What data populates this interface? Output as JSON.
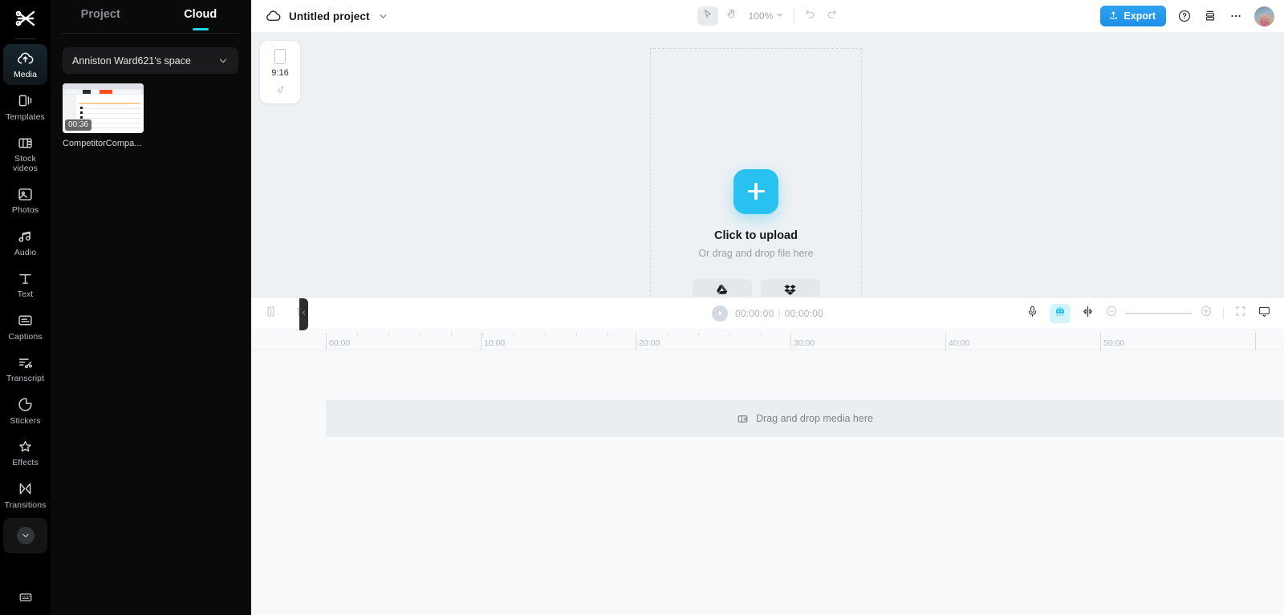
{
  "app": {
    "logo_icon": "capcut-logo-icon",
    "keyboard_shortcut_icon": "keyboard-icon"
  },
  "rail": {
    "items": [
      {
        "label": "Media",
        "icon": "cloud-upload-icon",
        "active": true
      },
      {
        "label": "Templates",
        "icon": "templates-icon",
        "active": false
      },
      {
        "label": "Stock videos",
        "icon": "film-strip-icon",
        "active": false
      },
      {
        "label": "Photos",
        "icon": "photo-icon",
        "active": false
      },
      {
        "label": "Audio",
        "icon": "music-note-icon",
        "active": false
      },
      {
        "label": "Text",
        "icon": "text-t-icon",
        "active": false
      },
      {
        "label": "Captions",
        "icon": "captions-icon",
        "active": false
      },
      {
        "label": "Transcript",
        "icon": "transcript-icon",
        "active": false
      },
      {
        "label": "Stickers",
        "icon": "sticker-icon",
        "active": false
      },
      {
        "label": "Effects",
        "icon": "sparkle-star-icon",
        "active": false
      },
      {
        "label": "Transitions",
        "icon": "transitions-icon",
        "active": false
      }
    ],
    "more_icon": "chevron-down-icon"
  },
  "panel": {
    "tabs": [
      {
        "label": "Project",
        "active": false
      },
      {
        "label": "Cloud",
        "active": true
      }
    ],
    "space_selector": {
      "value": "Anniston Ward621's space",
      "chevron_icon": "chevron-down-icon"
    },
    "media": [
      {
        "name": "CompetitorCompa...",
        "duration": "00:36"
      }
    ],
    "collapse_icon": "chevron-left-icon"
  },
  "topbar": {
    "cloud_icon": "cloud-icon",
    "project_title": "Untitled project",
    "title_chevron_icon": "chevron-down-icon",
    "tools": [
      {
        "name": "select-tool",
        "icon": "cursor-arrow-icon",
        "selected": true
      },
      {
        "name": "hand-tool",
        "icon": "hand-icon",
        "selected": false
      }
    ],
    "zoom_level": "100%",
    "zoom_chevron_icon": "chevron-down-icon",
    "undo_icon": "undo-icon",
    "redo_icon": "redo-icon",
    "export_label": "Export",
    "export_icon": "upload-icon",
    "help_icon": "question-circle-icon",
    "layout_icon": "layout-icon",
    "more_icon": "ellipsis-icon",
    "avatar_icon": "avatar"
  },
  "canvas": {
    "ratio_card": {
      "ratio": "9:16",
      "frame_icon": "phone-frame-icon",
      "platform_icon": "tiktok-icon"
    },
    "upload": {
      "plus_icon": "plus-icon",
      "title": "Click to upload",
      "subtitle": "Or drag and drop file here",
      "sources": [
        {
          "name": "google-drive-button",
          "icon": "google-drive-icon"
        },
        {
          "name": "dropbox-button",
          "icon": "dropbox-icon"
        }
      ]
    }
  },
  "timeline": {
    "split_icon": "split-icon",
    "delete_icon": "trash-icon",
    "play_icon": "play-icon",
    "current_time": "00:00:00",
    "total_time": "00:00:00",
    "time_separator": "|",
    "tools": [
      {
        "name": "voiceover-button",
        "icon": "microphone-icon",
        "active": false
      },
      {
        "name": "ai-tools-button",
        "icon": "ai-magic-icon",
        "active": true
      },
      {
        "name": "keyframe-button",
        "icon": "keyframe-icon",
        "active": false
      }
    ],
    "zoom_out_icon": "minus-circle-icon",
    "zoom_in_icon": "plus-circle-icon",
    "fit_icon": "fit-screen-icon",
    "preview_icon": "monitor-icon",
    "ruler_labels": [
      "00:00",
      "10:00",
      "20:00",
      "30:00",
      "40:00",
      "50:00"
    ],
    "drop_hint": "Drag and drop media here",
    "drop_hint_icon": "film-strip-icon"
  },
  "colors": {
    "accent_cyan": "#19d5e5",
    "upload_blue": "#29c2f0",
    "export_blue": "#1e8fe8",
    "rail_bg": "#000000",
    "panel_bg": "#0a0a0a",
    "canvas_bg": "#eef1f4",
    "ai_highlight": "#d3f4fb"
  }
}
